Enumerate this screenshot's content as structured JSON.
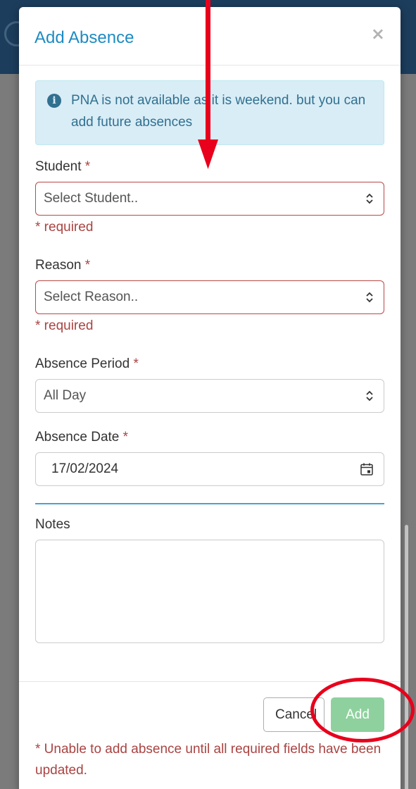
{
  "modal": {
    "title": "Add Absence",
    "close_symbol": "×",
    "info_alert": "PNA is not available as it is weekend. but you can add future absences",
    "student": {
      "label": "Student",
      "required_mark": "*",
      "placeholder": "Select Student..",
      "error": "* required"
    },
    "reason": {
      "label": "Reason",
      "required_mark": "*",
      "placeholder": "Select Reason..",
      "error": "* required"
    },
    "absence_period": {
      "label": "Absence Period",
      "required_mark": "*",
      "value": "All Day"
    },
    "absence_date": {
      "label": "Absence Date",
      "required_mark": "*",
      "value": "17/02/2024"
    },
    "notes": {
      "label": "Notes",
      "value": ""
    },
    "footer": {
      "cancel_label": "Cancel",
      "add_label": "Add",
      "error_message": "* Unable to add absence until all required fields have been updated."
    }
  },
  "icons": {
    "info": "info-circle-icon",
    "select_arrow": "chevron-up-down-icon",
    "calendar": "calendar-icon",
    "close": "close-icon"
  },
  "colors": {
    "title": "#1e8bc3",
    "alert_bg": "#d9edf7",
    "alert_text": "#31708f",
    "error": "#a94442",
    "add_button": "#8fd19e",
    "divider": "#45a3d8",
    "annotation": "#e8001c",
    "backdrop_header": "#1c3d5c"
  }
}
